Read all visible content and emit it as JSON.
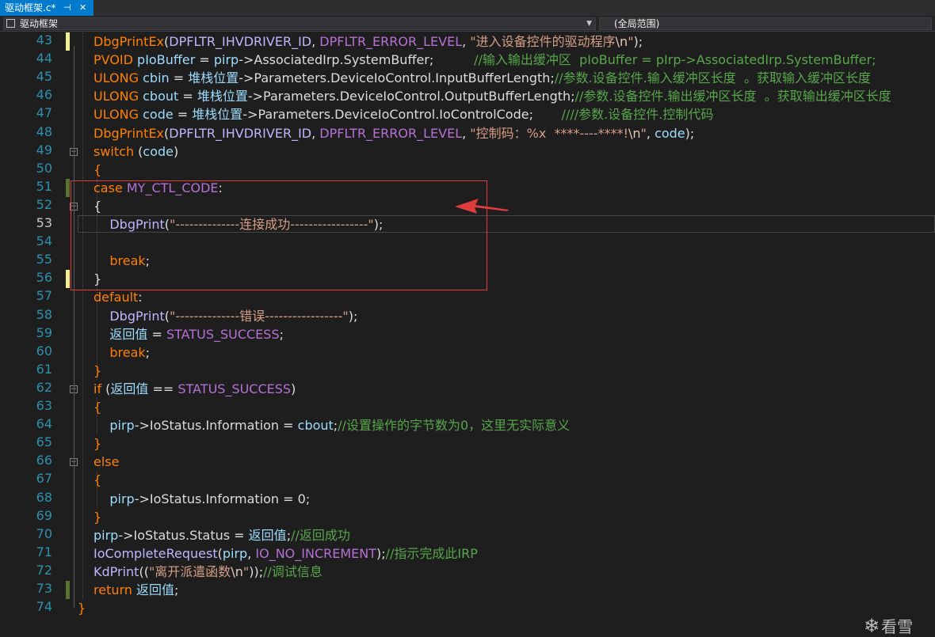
{
  "tab": {
    "title": "驱动框架.c*",
    "pin_glyph": "⊣",
    "close_glyph": "✕"
  },
  "navbar": {
    "left_scope": "驱动框架",
    "right_scope": "(全局范围)"
  },
  "watermark": "看雪",
  "colors": {
    "accent": "#007acc",
    "highlight_box": "#e03c3c",
    "line_number": "#2b91af"
  },
  "line_numbers": [
    "43",
    "44",
    "45",
    "46",
    "47",
    "48",
    "49",
    "50",
    "51",
    "52",
    "53",
    "54",
    "55",
    "56",
    "57",
    "58",
    "59",
    "60",
    "61",
    "62",
    "63",
    "64",
    "65",
    "66",
    "67",
    "68",
    "69",
    "70",
    "71",
    "72",
    "73",
    "74"
  ],
  "code_lines": [
    [
      [
        "fn",
        "DbgPrintEx"
      ],
      [
        "txt",
        "("
      ],
      [
        "mac",
        "DPFLTR_IHVDRIVER_ID"
      ],
      [
        "txt",
        ", "
      ],
      [
        "purple",
        "DPFLTR_ERROR_LEVEL"
      ],
      [
        "txt",
        ", "
      ],
      [
        "str",
        "\"进入设备控件的驱动程序"
      ],
      [
        "esc",
        "\\n"
      ],
      [
        "str",
        "\""
      ],
      [
        "txt",
        ");"
      ]
    ],
    [
      [
        "orange",
        "PVOID"
      ],
      [
        "txt",
        " "
      ],
      [
        "var",
        "pIoBuffer"
      ],
      [
        "txt",
        " = "
      ],
      [
        "var",
        "pirp"
      ],
      [
        "txt",
        "->"
      ],
      [
        "txt",
        "AssociatedIrp.SystemBuffer;"
      ],
      [
        "txt",
        "          "
      ],
      [
        "cm",
        "//输入输出缓冲区  pIoBuffer = pIrp->AssociatedIrp.SystemBuffer;"
      ]
    ],
    [
      [
        "orange",
        "ULONG"
      ],
      [
        "txt",
        " "
      ],
      [
        "var",
        "cbin"
      ],
      [
        "txt",
        " = "
      ],
      [
        "var",
        "堆栈位置"
      ],
      [
        "txt",
        "->Parameters.DeviceIoControl.InputBufferLength;"
      ],
      [
        "cm",
        "//参数.设备控件.输入缓冲区长度  。获取输入缓冲区长度"
      ]
    ],
    [
      [
        "orange",
        "ULONG"
      ],
      [
        "txt",
        " "
      ],
      [
        "var",
        "cbout"
      ],
      [
        "txt",
        " = "
      ],
      [
        "var",
        "堆栈位置"
      ],
      [
        "txt",
        "->Parameters.DeviceIoControl.OutputBufferLength;"
      ],
      [
        "cm",
        "//参数.设备控件.输出缓冲区长度  。获取输出缓冲区长度"
      ]
    ],
    [
      [
        "orange",
        "ULONG"
      ],
      [
        "txt",
        " "
      ],
      [
        "var",
        "code"
      ],
      [
        "txt",
        " = "
      ],
      [
        "var",
        "堆栈位置"
      ],
      [
        "txt",
        "->Parameters.DeviceIoControl.IoControlCode;"
      ],
      [
        "txt",
        "       "
      ],
      [
        "cm",
        "////参数.设备控件.控制代码"
      ]
    ],
    [
      [
        "fn",
        "DbgPrintEx"
      ],
      [
        "txt",
        "("
      ],
      [
        "mac",
        "DPFLTR_IHVDRIVER_ID"
      ],
      [
        "txt",
        ", "
      ],
      [
        "purple",
        "DPFLTR_ERROR_LEVEL"
      ],
      [
        "txt",
        ", "
      ],
      [
        "str",
        "\"控制码：%x  ****----****!"
      ],
      [
        "esc",
        "\\n"
      ],
      [
        "str",
        "\""
      ],
      [
        "txt",
        ", "
      ],
      [
        "var",
        "code"
      ],
      [
        "txt",
        ");"
      ]
    ],
    [
      [
        "orange",
        "switch"
      ],
      [
        "txt",
        " ("
      ],
      [
        "var",
        "code"
      ],
      [
        "txt",
        ")"
      ]
    ],
    [
      [
        "orange",
        "{"
      ]
    ],
    [
      [
        "orange",
        "case"
      ],
      [
        "txt",
        " "
      ],
      [
        "purple",
        "MY_CTL_CODE"
      ],
      [
        "txt",
        ":"
      ]
    ],
    [
      [
        "txt",
        "{"
      ]
    ],
    [
      [
        "txt",
        "    "
      ],
      [
        "mac",
        "DbgPrint"
      ],
      [
        "txt",
        "("
      ],
      [
        "str",
        "\"--------------连接成功-----------------\""
      ],
      [
        "txt",
        ");"
      ]
    ],
    [
      [
        "txt",
        ""
      ]
    ],
    [
      [
        "txt",
        "    "
      ],
      [
        "orange",
        "break"
      ],
      [
        "txt",
        ";"
      ]
    ],
    [
      [
        "txt",
        "}"
      ]
    ],
    [
      [
        "orange",
        "default"
      ],
      [
        "txt",
        ":"
      ]
    ],
    [
      [
        "txt",
        "    "
      ],
      [
        "mac",
        "DbgPrint"
      ],
      [
        "txt",
        "("
      ],
      [
        "str",
        "\"--------------错误-----------------\""
      ],
      [
        "txt",
        ");"
      ]
    ],
    [
      [
        "txt",
        "    "
      ],
      [
        "var",
        "返回值"
      ],
      [
        "txt",
        " = "
      ],
      [
        "purple",
        "STATUS_SUCCESS"
      ],
      [
        "txt",
        ";"
      ]
    ],
    [
      [
        "txt",
        "    "
      ],
      [
        "orange",
        "break"
      ],
      [
        "txt",
        ";"
      ]
    ],
    [
      [
        "orange",
        "}"
      ]
    ],
    [
      [
        "orange",
        "if"
      ],
      [
        "txt",
        " ("
      ],
      [
        "var",
        "返回值"
      ],
      [
        "txt",
        " == "
      ],
      [
        "purple",
        "STATUS_SUCCESS"
      ],
      [
        "txt",
        ")"
      ]
    ],
    [
      [
        "orange",
        "{"
      ]
    ],
    [
      [
        "txt",
        "    "
      ],
      [
        "var",
        "pirp"
      ],
      [
        "txt",
        "->IoStatus.Information = "
      ],
      [
        "var",
        "cbout"
      ],
      [
        "txt",
        ";"
      ],
      [
        "cm",
        "//设置操作的字节数为0，这里无实际意义"
      ]
    ],
    [
      [
        "orange",
        "}"
      ]
    ],
    [
      [
        "orange",
        "else"
      ]
    ],
    [
      [
        "orange",
        "{"
      ]
    ],
    [
      [
        "txt",
        "    "
      ],
      [
        "var",
        "pirp"
      ],
      [
        "txt",
        "->IoStatus.Information = 0;"
      ]
    ],
    [
      [
        "orange",
        "}"
      ]
    ],
    [
      [
        "var",
        "pirp"
      ],
      [
        "txt",
        "->IoStatus.Status = "
      ],
      [
        "var",
        "返回值"
      ],
      [
        "txt",
        ";"
      ],
      [
        "cm",
        "//返回成功"
      ]
    ],
    [
      [
        "mac",
        "IoCompleteRequest"
      ],
      [
        "txt",
        "("
      ],
      [
        "var",
        "pirp"
      ],
      [
        "txt",
        ", "
      ],
      [
        "purple",
        "IO_NO_INCREMENT"
      ],
      [
        "txt",
        ");"
      ],
      [
        "cm",
        "//指示完成此IRP"
      ]
    ],
    [
      [
        "mac",
        "KdPrint"
      ],
      [
        "txt",
        "(("
      ],
      [
        "str",
        "\"离开派遣函数"
      ],
      [
        "esc",
        "\\n"
      ],
      [
        "str",
        "\""
      ],
      [
        "txt",
        "));"
      ],
      [
        "cm",
        "//调试信息"
      ]
    ],
    [
      [
        "orange",
        "return"
      ],
      [
        "txt",
        " "
      ],
      [
        "var",
        "返回值"
      ],
      [
        "txt",
        ";"
      ]
    ],
    [
      [
        "orange",
        "}"
      ]
    ]
  ]
}
